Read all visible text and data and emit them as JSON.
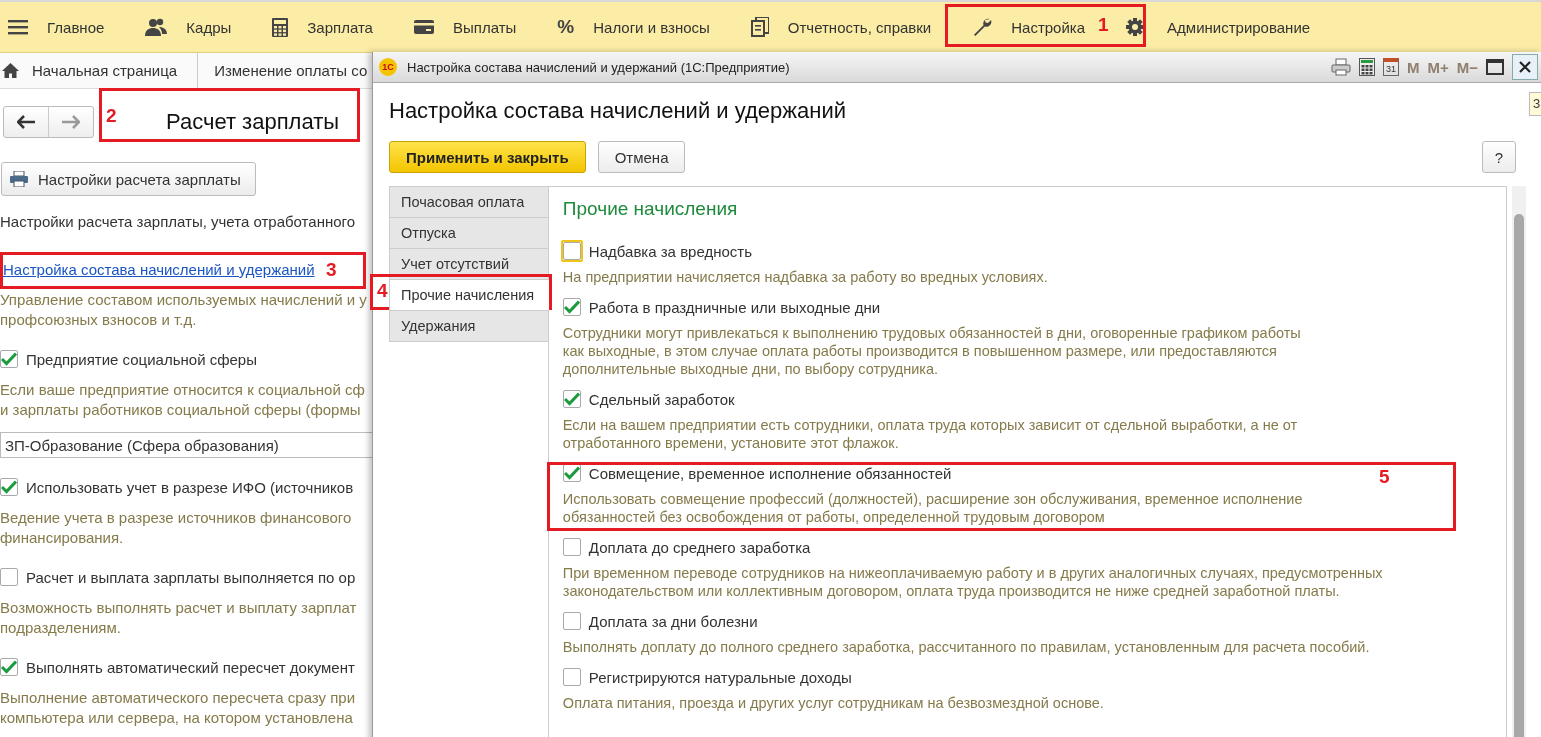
{
  "main_menu": [
    {
      "label": "Главное"
    },
    {
      "label": "Кадры"
    },
    {
      "label": "Зарплата"
    },
    {
      "label": "Выплаты"
    },
    {
      "glyph": "%",
      "label": "Налоги и взносы"
    },
    {
      "label": "Отчетность, справки"
    },
    {
      "label": "Настройка"
    },
    {
      "label": "Администрирование"
    }
  ],
  "page_tabs": [
    {
      "label": "Начальная страница"
    },
    {
      "label": "Изменение оплаты со"
    }
  ],
  "page": {
    "title": "Расчет зарплаты",
    "settings_button": "Настройки расчета зарплаты",
    "intro": "Настройки расчета зарплаты, учета отработанного",
    "link": "Настройка состава начислений и удержаний",
    "link_description": "Управление составом используемых начислений и у\nпрофсоюзных взносов и т.д.",
    "options": [
      {
        "kind": "checkbox",
        "label": "Предприятие социальной сферы",
        "checked": true,
        "description": "Если ваше предприятие относится к социальной сф\nи зарплаты работников социальной сферы (формы"
      },
      {
        "kind": "field",
        "value": "ЗП-Образование (Сфера образования)"
      },
      {
        "kind": "checkbox",
        "label": "Использовать учет в разрезе ИФО (источников",
        "checked": true,
        "description": "Ведение учета в разрезе источников финансового\nфинансирования."
      },
      {
        "kind": "checkbox",
        "label": "Расчет и выплата зарплаты выполняется по ор",
        "checked": false,
        "description": "Возможность выполнять расчет и выплату зарплат\nподразделениям."
      },
      {
        "kind": "checkbox",
        "label": "Выполнять автоматический пересчет документ",
        "checked": true,
        "description": "Выполнение автоматического пересчета сразу при\nкомпьютера или сервера, на котором установлена"
      }
    ]
  },
  "dialog": {
    "app_logo": "1С",
    "title": "Настройка состава начислений и удержаний (1С:Предприятие)",
    "calendar_day": "31",
    "memory_buttons": [
      {
        "label": "M",
        "disabled": true
      },
      {
        "label": "M+",
        "disabled": true
      },
      {
        "label": "M−",
        "disabled": true
      }
    ],
    "heading": "Настройка состава начислений и удержаний",
    "apply_button": "Применить и закрыть",
    "cancel_button": "Отмена",
    "help_button": "?",
    "tabs": [
      {
        "label": "Почасовая оплата",
        "selected": false
      },
      {
        "label": "Отпуска",
        "selected": false
      },
      {
        "label": "Учет отсутствий",
        "selected": false
      },
      {
        "label": "Прочие начисления",
        "selected": true
      },
      {
        "label": "Удержания",
        "selected": false
      }
    ],
    "section_title": "Прочие начисления",
    "options": [
      {
        "label": "Надбавка за вредность",
        "checked": false,
        "focused": true,
        "description": "На предприятии начисляется надбавка за работу во вредных условиях."
      },
      {
        "label": "Работа в праздничные или выходные дни",
        "checked": true,
        "focused": false,
        "description": "Сотрудники могут привлекаться к выполнению трудовых обязанностей в дни, оговоренные графиком работы\nкак выходные, в этом случае оплата работы производится в повышенном размере, или предоставляются\nдополнительные выходные дни, по выбору сотрудника."
      },
      {
        "label": "Сдельный заработок",
        "checked": true,
        "focused": false,
        "description": "Если на вашем предприятии есть сотрудники, оплата труда которых зависит от сдельной выработки, а не от\nотработанного времени, установите этот флажок."
      },
      {
        "label": "Совмещение, временное исполнение обязанностей",
        "checked": true,
        "focused": false,
        "description": "Использовать совмещение профессий (должностей), расширение зон обслуживания, временное исполнение\nобязанностей без освобождения от работы, определенной трудовым договором"
      },
      {
        "label": "Доплата до среднего заработка",
        "checked": false,
        "focused": false,
        "description": "При временном переводе сотрудников на нижеоплачиваемую работу и в других аналогичных случаях, предусмотренных\nзаконодательством или коллективным договором, оплата труда производится не ниже средней заработной платы."
      },
      {
        "label": "Доплата за дни болезни",
        "checked": false,
        "focused": false,
        "description": "Выполнять доплату до полного среднего заработка, рассчитанного по правилам, установленным для расчета пособий."
      },
      {
        "label": "Регистрируются натуральные доходы",
        "checked": false,
        "focused": false,
        "description": "Оплата питания, проезда и других услуг сотрудникам на безвозмездной основе."
      }
    ]
  },
  "tooltip": "З",
  "annotations": [
    {
      "number": "1"
    },
    {
      "number": "2"
    },
    {
      "number": "3"
    },
    {
      "number": "4"
    },
    {
      "number": "5"
    }
  ]
}
